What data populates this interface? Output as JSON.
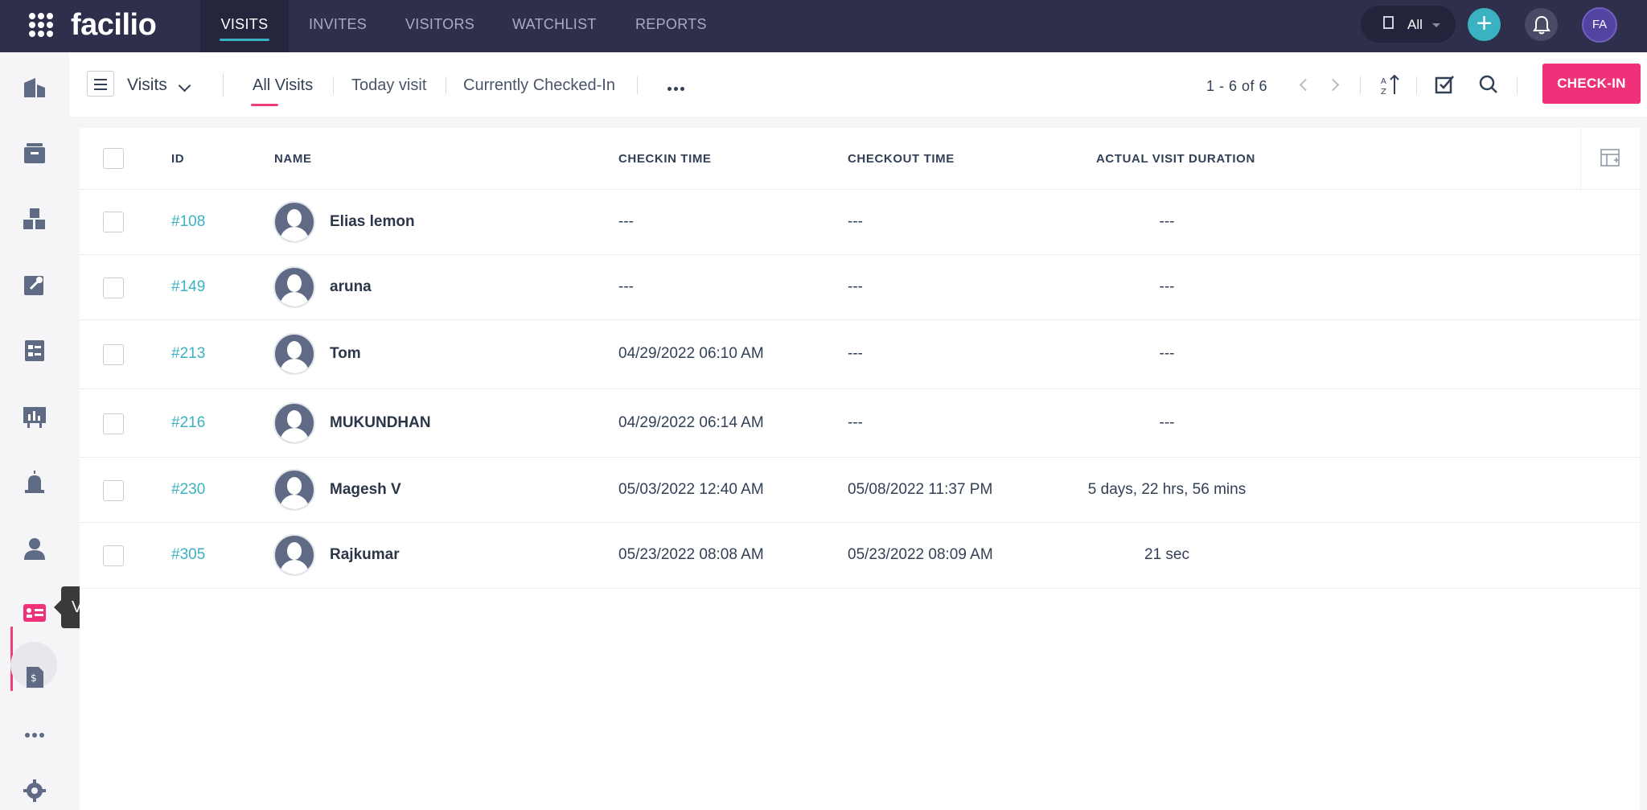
{
  "app": {
    "logo": "facilio"
  },
  "topnav": {
    "tabs": [
      {
        "label": "VISITS",
        "active": true
      },
      {
        "label": "INVITES",
        "active": false
      },
      {
        "label": "VISITORS",
        "active": false
      },
      {
        "label": "WATCHLIST",
        "active": false
      },
      {
        "label": "REPORTS",
        "active": false
      }
    ],
    "site_filter": "All",
    "user_initials": "FA"
  },
  "sidebar": {
    "items": [
      "portfolio-icon",
      "inventory-icon",
      "assets-icon",
      "maintenance-icon",
      "workorders-icon",
      "analytics-icon",
      "alarms-icon",
      "people-icon",
      "visitor-icon",
      "budget-icon",
      "more-icon",
      "settings-icon"
    ],
    "active_item": "Visitor",
    "tooltip": "Visitor"
  },
  "subheader": {
    "view_name": "Visits",
    "tabs": [
      {
        "label": "All Visits",
        "active": true
      },
      {
        "label": "Today visit",
        "active": false
      },
      {
        "label": "Currently Checked-In",
        "active": false
      }
    ],
    "pagination": "1 - 6 of 6",
    "checkin_label": "CHECK-IN"
  },
  "table": {
    "columns": [
      "ID",
      "NAME",
      "CHECKIN TIME",
      "CHECKOUT TIME",
      "ACTUAL VISIT DURATION"
    ],
    "rows": [
      {
        "id": "#108",
        "name": "Elias lemon",
        "checkin": "---",
        "checkout": "---",
        "duration": "---"
      },
      {
        "id": "#149",
        "name": "aruna",
        "checkin": "---",
        "checkout": "---",
        "duration": "---"
      },
      {
        "id": "#213",
        "name": "Tom",
        "checkin": "04/29/2022 06:10 AM",
        "checkout": "---",
        "duration": "---"
      },
      {
        "id": "#216",
        "name": "MUKUNDHAN",
        "checkin": "04/29/2022 06:14 AM",
        "checkout": "---",
        "duration": "---"
      },
      {
        "id": "#230",
        "name": "Magesh V",
        "checkin": "05/03/2022 12:40 AM",
        "checkout": "05/08/2022 11:37 PM",
        "duration": "5 days, 22 hrs, 56 mins"
      },
      {
        "id": "#305",
        "name": "Rajkumar",
        "checkin": "05/23/2022 08:08 AM",
        "checkout": "05/23/2022 08:09 AM",
        "duration": "21 sec"
      }
    ]
  },
  "colors": {
    "topbar": "#2e2f4a",
    "accent_teal": "#3ab2c2",
    "accent_pink": "#ef3179",
    "active_tab_underline": "#ef3e78"
  }
}
